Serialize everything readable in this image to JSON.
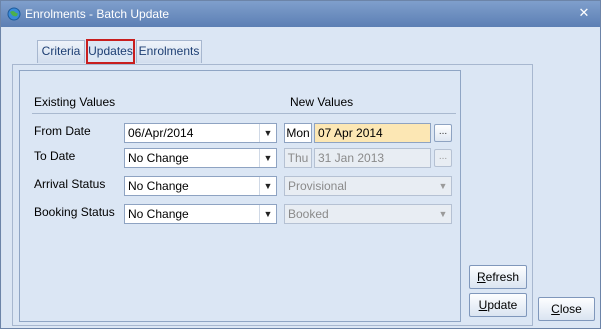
{
  "window": {
    "title": "Enrolments - Batch Update",
    "close_glyph": "✕"
  },
  "tabs": [
    {
      "label": "Criteria",
      "active": false
    },
    {
      "label": "Updates",
      "active": true
    },
    {
      "label": "Enrolments",
      "active": false
    }
  ],
  "headers": {
    "existing": "Existing Values",
    "new": "New Values"
  },
  "rows": {
    "from_date": {
      "label": "From Date",
      "existing_value": "06/Apr/2014",
      "new_day": "Mon",
      "new_date": "07 Apr 2014",
      "new_enabled": true
    },
    "to_date": {
      "label": "To Date",
      "existing_value": "No Change",
      "new_day": "Thu",
      "new_date": "31 Jan 2013",
      "new_enabled": false
    },
    "arrival_status": {
      "label": "Arrival Status",
      "existing_value": "No Change",
      "new_value": "Provisional",
      "new_enabled": false
    },
    "booking_status": {
      "label": "Booking Status",
      "existing_value": "No Change",
      "new_value": "Booked",
      "new_enabled": false
    }
  },
  "buttons": {
    "refresh_first": "R",
    "refresh_rest": "efresh",
    "update_first": "U",
    "update_rest": "pdate",
    "close_first": "C",
    "close_rest": "lose",
    "ellipsis": "..."
  },
  "icons": {
    "app": "globe-icon",
    "dropdown": "chevron-down-icon",
    "dropdown_glyph": "▼"
  }
}
